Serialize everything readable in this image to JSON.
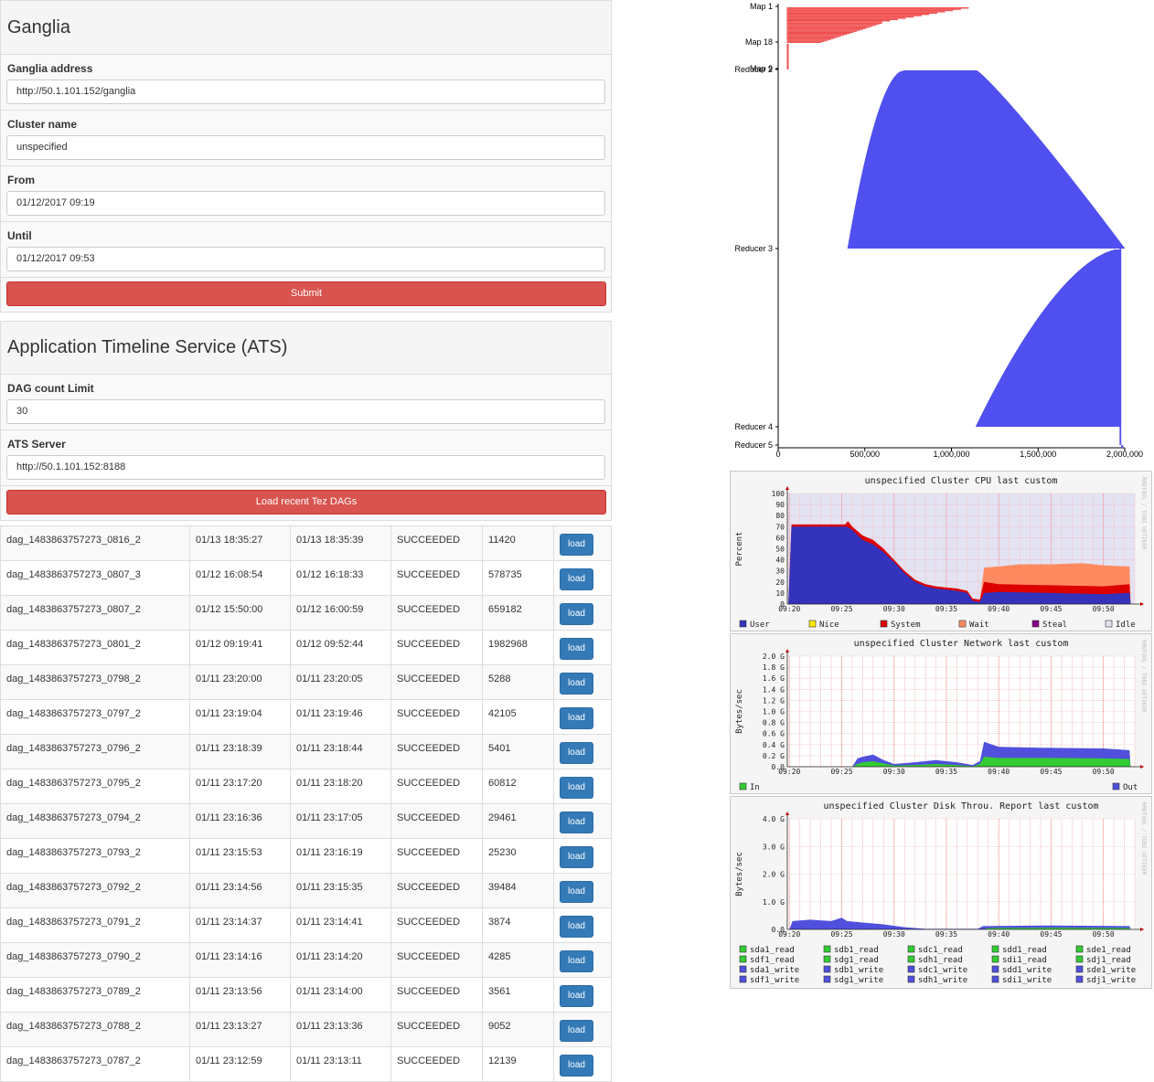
{
  "ganglia": {
    "title": "Ganglia",
    "address_label": "Ganglia address",
    "address_value": "http://50.1.101.152/ganglia",
    "cluster_label": "Cluster name",
    "cluster_value": "unspecified",
    "from_label": "From",
    "from_value": "01/12/2017 09:19",
    "until_label": "Until",
    "until_value": "01/12/2017 09:53",
    "submit_label": "Submit"
  },
  "ats": {
    "title": "Application Timeline Service (ATS)",
    "dag_limit_label": "DAG count Limit",
    "dag_limit_value": "30",
    "server_label": "ATS Server",
    "server_value": "http://50.1.101.152:8188",
    "load_label": "Load recent Tez DAGs"
  },
  "dags": [
    {
      "id": "dag_1483863757273_0816_2",
      "start": "01/13 18:35:27",
      "end": "01/13 18:35:39",
      "status": "SUCCEEDED",
      "duration": "11420",
      "action": "load"
    },
    {
      "id": "dag_1483863757273_0807_3",
      "start": "01/12 16:08:54",
      "end": "01/12 16:18:33",
      "status": "SUCCEEDED",
      "duration": "578735",
      "action": "load"
    },
    {
      "id": "dag_1483863757273_0807_2",
      "start": "01/12 15:50:00",
      "end": "01/12 16:00:59",
      "status": "SUCCEEDED",
      "duration": "659182",
      "action": "load"
    },
    {
      "id": "dag_1483863757273_0801_2",
      "start": "01/12 09:19:41",
      "end": "01/12 09:52:44",
      "status": "SUCCEEDED",
      "duration": "1982968",
      "action": "load"
    },
    {
      "id": "dag_1483863757273_0798_2",
      "start": "01/11 23:20:00",
      "end": "01/11 23:20:05",
      "status": "SUCCEEDED",
      "duration": "5288",
      "action": "load"
    },
    {
      "id": "dag_1483863757273_0797_2",
      "start": "01/11 23:19:04",
      "end": "01/11 23:19:46",
      "status": "SUCCEEDED",
      "duration": "42105",
      "action": "load"
    },
    {
      "id": "dag_1483863757273_0796_2",
      "start": "01/11 23:18:39",
      "end": "01/11 23:18:44",
      "status": "SUCCEEDED",
      "duration": "5401",
      "action": "load"
    },
    {
      "id": "dag_1483863757273_0795_2",
      "start": "01/11 23:17:20",
      "end": "01/11 23:18:20",
      "status": "SUCCEEDED",
      "duration": "60812",
      "action": "load"
    },
    {
      "id": "dag_1483863757273_0794_2",
      "start": "01/11 23:16:36",
      "end": "01/11 23:17:05",
      "status": "SUCCEEDED",
      "duration": "29461",
      "action": "load"
    },
    {
      "id": "dag_1483863757273_0793_2",
      "start": "01/11 23:15:53",
      "end": "01/11 23:16:19",
      "status": "SUCCEEDED",
      "duration": "25230",
      "action": "load"
    },
    {
      "id": "dag_1483863757273_0792_2",
      "start": "01/11 23:14:56",
      "end": "01/11 23:15:35",
      "status": "SUCCEEDED",
      "duration": "39484",
      "action": "load"
    },
    {
      "id": "dag_1483863757273_0791_2",
      "start": "01/11 23:14:37",
      "end": "01/11 23:14:41",
      "status": "SUCCEEDED",
      "duration": "3874",
      "action": "load"
    },
    {
      "id": "dag_1483863757273_0790_2",
      "start": "01/11 23:14:16",
      "end": "01/11 23:14:20",
      "status": "SUCCEEDED",
      "duration": "4285",
      "action": "load"
    },
    {
      "id": "dag_1483863757273_0789_2",
      "start": "01/11 23:13:56",
      "end": "01/11 23:14:00",
      "status": "SUCCEEDED",
      "duration": "3561",
      "action": "load"
    },
    {
      "id": "dag_1483863757273_0788_2",
      "start": "01/11 23:13:27",
      "end": "01/11 23:13:36",
      "status": "SUCCEEDED",
      "duration": "9052",
      "action": "load"
    },
    {
      "id": "dag_1483863757273_0787_2",
      "start": "01/11 23:12:59",
      "end": "01/11 23:13:11",
      "status": "SUCCEEDED",
      "duration": "12139",
      "action": "load"
    }
  ],
  "chart_data": [
    {
      "type": "bar",
      "orientation": "horizontal",
      "title": "",
      "xlabel": "",
      "ylabel": "",
      "xlim": [
        0,
        2000000
      ],
      "x_ticks": [
        "0",
        "500,000",
        "1,000,000",
        "1,500,000",
        "2,000,000"
      ],
      "y_labels": [
        "Map 1",
        "Map 18",
        "Map 9",
        "Reducer 2",
        "Reducer 3",
        "Reducer 4",
        "Reducer 5"
      ],
      "groups": [
        {
          "name": "Map 1",
          "color": "#f05050",
          "start": 50000,
          "end_range": [
            600000,
            1100000
          ]
        },
        {
          "name": "Map 18",
          "color": "#f05050",
          "start": 50000,
          "end_range": [
            250000,
            600000
          ]
        },
        {
          "name": "Map 9",
          "color": "#f05050",
          "start": 50000,
          "end_range": [
            60000,
            60000
          ]
        },
        {
          "name": "Reducer 2",
          "color": "#5050f0",
          "start_range": [
            400000,
            720000
          ],
          "end_range": [
            1150000,
            2000000
          ]
        },
        {
          "name": "Reducer 3",
          "color": "#5050f0",
          "start_range": [
            1140000,
            1970000
          ],
          "end_range": [
            1970000,
            1980000
          ]
        },
        {
          "name": "Reducer 4",
          "color": "#5050f0",
          "start": 1970000,
          "end": 1980000
        },
        {
          "name": "Reducer 5",
          "color": "#5050f0",
          "start": 1980000,
          "end": 1982968
        }
      ]
    },
    {
      "type": "area",
      "title": "unspecified Cluster CPU last custom",
      "ylabel": "Percent",
      "side_label": "RRDTOOL / TOBI OETIKER",
      "ylim": [
        0,
        100
      ],
      "y_ticks": [
        "0",
        "10",
        "20",
        "30",
        "40",
        "50",
        "60",
        "70",
        "80",
        "90",
        "100"
      ],
      "x_ticks": [
        "09:20",
        "09:25",
        "09:30",
        "09:35",
        "09:40",
        "09:45",
        "09:50"
      ],
      "x_range_minutes": [
        19.8,
        53.0
      ],
      "series": [
        {
          "name": "User",
          "color": "#3333bb",
          "points": [
            [
              19.9,
              0
            ],
            [
              20.2,
              70
            ],
            [
              24,
              70
            ],
            [
              25.5,
              70
            ],
            [
              26,
              67
            ],
            [
              27,
              58
            ],
            [
              28,
              54
            ],
            [
              29,
              47
            ],
            [
              30,
              38
            ],
            [
              31,
              28
            ],
            [
              32,
              20
            ],
            [
              33,
              16
            ],
            [
              34,
              14
            ],
            [
              35,
              13
            ],
            [
              36,
              12
            ],
            [
              37,
              10
            ],
            [
              37.5,
              3
            ],
            [
              38.2,
              2
            ],
            [
              38.6,
              10
            ],
            [
              40,
              11
            ],
            [
              45,
              10
            ],
            [
              50,
              9
            ],
            [
              52.5,
              10
            ],
            [
              52.6,
              0
            ]
          ]
        },
        {
          "name": "Nice",
          "color": "#ffea00",
          "points": []
        },
        {
          "name": "System",
          "color": "#dd0000",
          "points": [
            [
              19.9,
              0
            ],
            [
              20.2,
              72
            ],
            [
              25.3,
              72
            ],
            [
              25.6,
              75
            ],
            [
              26,
              70
            ],
            [
              27,
              62
            ],
            [
              28,
              58
            ],
            [
              29,
              50
            ],
            [
              30,
              40
            ],
            [
              31,
              30
            ],
            [
              32,
              22
            ],
            [
              33,
              18
            ],
            [
              34,
              16
            ],
            [
              35,
              15
            ],
            [
              36,
              14
            ],
            [
              37,
              12
            ],
            [
              37.5,
              5
            ],
            [
              38.2,
              4
            ],
            [
              38.6,
              20
            ],
            [
              40,
              18
            ],
            [
              45,
              17
            ],
            [
              50,
              16
            ],
            [
              52.5,
              18
            ],
            [
              52.6,
              0
            ]
          ]
        },
        {
          "name": "Wait",
          "color": "#ff8a60",
          "points": [
            [
              38.2,
              4
            ],
            [
              38.6,
              33
            ],
            [
              40,
              34
            ],
            [
              42,
              36
            ],
            [
              45,
              36
            ],
            [
              48,
              37
            ],
            [
              50,
              35
            ],
            [
              52.5,
              34
            ],
            [
              52.6,
              0
            ]
          ]
        },
        {
          "name": "Steal",
          "color": "#880088",
          "points": []
        },
        {
          "name": "Idle",
          "color": "#e2e2f2",
          "points": []
        }
      ]
    },
    {
      "type": "area",
      "title": "unspecified Cluster Network last custom",
      "ylabel": "Bytes/sec",
      "side_label": "RRDTOOL / TOBI OETIKER",
      "ylim": [
        0,
        2.0
      ],
      "y_ticks": [
        "0.0",
        "0.2 G",
        "0.4 G",
        "0.6 G",
        "0.8 G",
        "1.0 G",
        "1.2 G",
        "1.4 G",
        "1.6 G",
        "1.8 G",
        "2.0 G"
      ],
      "x_ticks": [
        "09:20",
        "09:25",
        "09:30",
        "09:35",
        "09:40",
        "09:45",
        "09:50"
      ],
      "x_range_minutes": [
        19.8,
        53.0
      ],
      "series": [
        {
          "name": "In",
          "color": "#33cc33",
          "points": [
            [
              19.9,
              0
            ],
            [
              26,
              0
            ],
            [
              26.5,
              0.05
            ],
            [
              27,
              0.08
            ],
            [
              28,
              0.1
            ],
            [
              29,
              0.06
            ],
            [
              30,
              0.02
            ],
            [
              32,
              0.03
            ],
            [
              34,
              0.05
            ],
            [
              36,
              0.03
            ],
            [
              37.5,
              0.01
            ],
            [
              38.2,
              0.05
            ],
            [
              38.6,
              0.18
            ],
            [
              40,
              0.16
            ],
            [
              45,
              0.16
            ],
            [
              50,
              0.15
            ],
            [
              52.5,
              0.14
            ],
            [
              52.6,
              0
            ]
          ]
        },
        {
          "name": "Out",
          "color": "#5050dd",
          "points": [
            [
              19.9,
              0
            ],
            [
              26,
              0
            ],
            [
              26.5,
              0.15
            ],
            [
              27,
              0.18
            ],
            [
              28,
              0.22
            ],
            [
              29,
              0.12
            ],
            [
              30,
              0.05
            ],
            [
              32,
              0.08
            ],
            [
              34,
              0.12
            ],
            [
              36,
              0.08
            ],
            [
              37.5,
              0.03
            ],
            [
              38.2,
              0.1
            ],
            [
              38.6,
              0.45
            ],
            [
              40,
              0.36
            ],
            [
              45,
              0.34
            ],
            [
              50,
              0.33
            ],
            [
              52.5,
              0.3
            ],
            [
              52.6,
              0
            ]
          ]
        }
      ]
    },
    {
      "type": "area",
      "title": "unspecified Cluster Disk Throu. Report last custom",
      "ylabel": "Bytes/sec",
      "side_label": "RRDTOOL / TOBI OETIKER",
      "ylim": [
        0,
        4.0
      ],
      "y_ticks": [
        "0.0",
        "1.0 G",
        "2.0 G",
        "3.0 G",
        "4.0 G"
      ],
      "x_ticks": [
        "09:20",
        "09:25",
        "09:30",
        "09:35",
        "09:40",
        "09:45",
        "09:50"
      ],
      "x_range_minutes": [
        19.8,
        53.0
      ],
      "legend": [
        "sda1_read",
        "sdb1_read",
        "sdc1_read",
        "sdd1_read",
        "sde1_read",
        "sdf1_read",
        "sdg1_read",
        "sdh1_read",
        "sdi1_read",
        "sdj1_read",
        "sda1_write",
        "sdb1_write",
        "sdc1_write",
        "sdd1_write",
        "sde1_write",
        "sdf1_write",
        "sdg1_write",
        "sdh1_write",
        "sdi1_write",
        "sdj1_write"
      ],
      "series": [
        {
          "name": "write",
          "color": "#5050dd",
          "points": [
            [
              20,
              0
            ],
            [
              20.3,
              0.3
            ],
            [
              22,
              0.35
            ],
            [
              24,
              0.3
            ],
            [
              25,
              0.42
            ],
            [
              25.5,
              0.3
            ],
            [
              27,
              0.25
            ],
            [
              29,
              0.18
            ],
            [
              31,
              0.08
            ],
            [
              33,
              0.02
            ],
            [
              38,
              0.02
            ],
            [
              38.5,
              0.12
            ],
            [
              45,
              0.14
            ],
            [
              52.5,
              0.12
            ],
            [
              52.6,
              0
            ]
          ]
        },
        {
          "name": "read",
          "color": "#33cc33",
          "points": [
            [
              38.5,
              0
            ],
            [
              39,
              0.05
            ],
            [
              45,
              0.06
            ],
            [
              52.5,
              0.05
            ],
            [
              52.6,
              0
            ]
          ]
        }
      ]
    }
  ]
}
